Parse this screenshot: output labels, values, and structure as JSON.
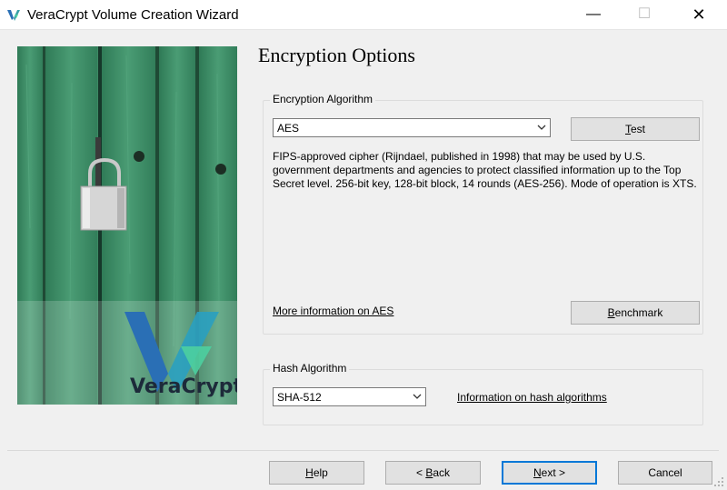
{
  "window": {
    "title": "VeraCrypt Volume Creation Wizard",
    "minimize": "—",
    "maximize": "☐",
    "close": "✕"
  },
  "branding": {
    "logo_text": "VeraCrypt"
  },
  "page": {
    "heading": "Encryption Options"
  },
  "encryption": {
    "legend": "Encryption Algorithm",
    "selected": "AES",
    "test_label_underlined": "T",
    "test_label_rest": "est",
    "description": "FIPS-approved cipher (Rijndael, published in 1998) that may be used by U.S. government departments and agencies to protect classified information up to the Top Secret level. 256-bit key, 128-bit block, 14 rounds (AES-256). Mode of operation is XTS.",
    "more_info_link": "More information on AES",
    "benchmark_label_underlined": "B",
    "benchmark_label_rest": "enchmark"
  },
  "hash": {
    "legend": "Hash Algorithm",
    "selected": "SHA-512",
    "info_link": "Information on hash algorithms"
  },
  "footer": {
    "help_underlined": "H",
    "help_rest": "elp",
    "back_prefix": "< ",
    "back_underlined": "B",
    "back_rest": "ack",
    "next_underlined": "N",
    "next_rest": "ext >",
    "cancel": "Cancel"
  },
  "colors": {
    "accent": "#0078d7",
    "door_green": "#3f8f6a",
    "logo_blue": "#2a6fb5"
  }
}
